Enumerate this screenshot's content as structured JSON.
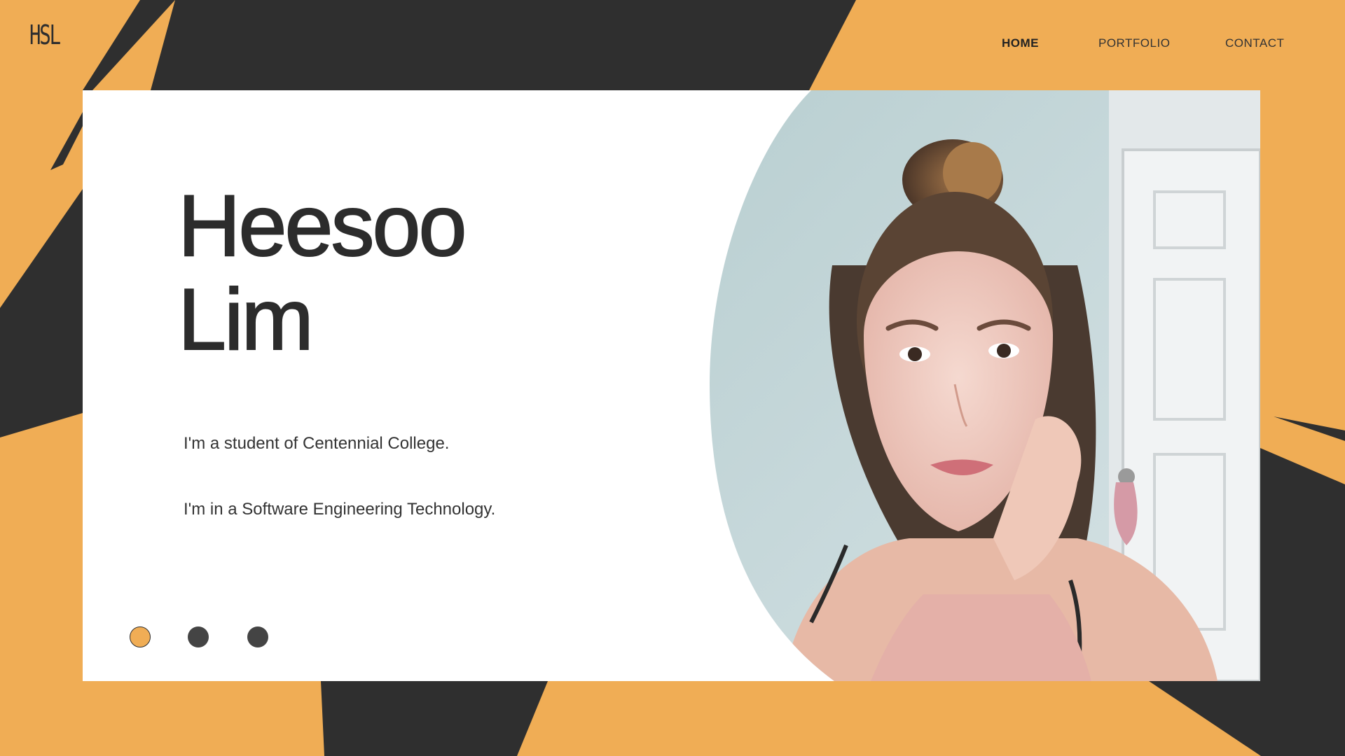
{
  "brand": {
    "logo_text": "HSL"
  },
  "nav": {
    "items": [
      {
        "label": "HOME",
        "active": true
      },
      {
        "label": "PORTFOLIO",
        "active": false
      },
      {
        "label": "CONTACT",
        "active": false
      }
    ]
  },
  "hero": {
    "name_first": "Heesoo",
    "name_last": "Lim",
    "line1": "I'm a student of Centennial College.",
    "line2": "I'm in a Software Engineering Technology."
  },
  "slider": {
    "count": 3,
    "active_index": 0
  },
  "colors": {
    "accent": "#f0ad55",
    "dark": "#2f2f2f",
    "card": "#ffffff",
    "dot_inactive": "#444444"
  }
}
